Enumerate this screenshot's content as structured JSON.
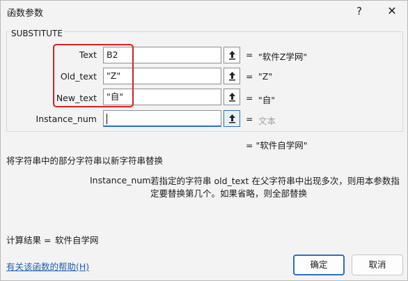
{
  "window": {
    "title": "函数参数",
    "help_label": "?",
    "close_label": "✕"
  },
  "function_group": {
    "name": "SUBSTITUTE"
  },
  "arguments": [
    {
      "label": "Text",
      "value": "B2",
      "result": "\"软件Z学网\"",
      "equals": "="
    },
    {
      "label": "Old_text",
      "value": "\"Z\"",
      "result": "\"Z\"",
      "equals": "="
    },
    {
      "label": "New_text",
      "value": "\"自\"",
      "result": "\"自\"",
      "equals": "="
    },
    {
      "label": "Instance_num",
      "value": "",
      "result": "文本",
      "equals": "="
    }
  ],
  "formula_result": "= \"软件自学网\"",
  "function_description": "将字符串中的部分字符串以新字符串替换",
  "parameter_help": {
    "name": "Instance_num",
    "description": "若指定的字符串 old_text 在父字符串中出现多次，则用本参数指定要替换第几个。如果省略，则全部替换"
  },
  "calculation": {
    "label": "计算结果 =",
    "value": "软件自学网"
  },
  "help_link": "有关该函数的帮助(H)",
  "buttons": {
    "ok": "确定",
    "cancel": "取消"
  },
  "colors": {
    "highlight": "#e02020",
    "accent": "#2b6ec2",
    "link": "#1f5fb5"
  },
  "icons": {
    "range_picker": "upload-arrow-icon"
  }
}
